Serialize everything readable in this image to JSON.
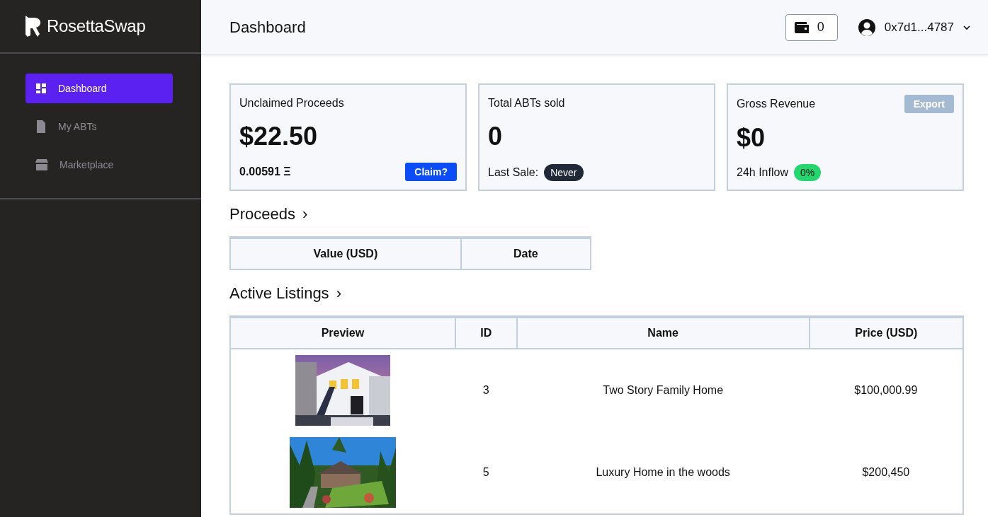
{
  "sidebar": {
    "brand": "RosettaSwap",
    "items": [
      {
        "label": "Dashboard",
        "kind": "grid",
        "selected": true
      },
      {
        "label": "My ABTs",
        "kind": "file",
        "selected": false
      },
      {
        "label": "Marketplace",
        "kind": "store",
        "selected": false
      }
    ]
  },
  "header": {
    "title": "Dashboard",
    "wallet_count": "0",
    "account": "0x7d1...4787"
  },
  "cards": [
    {
      "kind": "claim",
      "title": "Unclaimed Proceeds",
      "value": "$22.50",
      "amount": "0.00591 Ξ",
      "button": "Claim?"
    },
    {
      "kind": "sale",
      "title": "Total ABTs sold",
      "value": "0",
      "label": "Last Sale:",
      "badge": "Never"
    },
    {
      "kind": "revenue",
      "title": "Gross Revenue",
      "button": "Export",
      "value": "$0",
      "label": "24h Inflow",
      "badge": "0%"
    }
  ],
  "proceeds": {
    "title": "Proceeds",
    "chevron": "›",
    "columns": [
      "Value (USD)",
      "Date"
    ]
  },
  "listings": {
    "title": "Active Listings",
    "chevron": "›",
    "columns": [
      "Preview",
      "ID",
      "Name",
      "Price (USD)"
    ],
    "rows": [
      {
        "id": "3",
        "name": "Two Story Family Home",
        "price": "$100,000.99"
      },
      {
        "id": "5",
        "name": "Luxury Home in the woods",
        "price": "$200,450"
      }
    ]
  }
}
